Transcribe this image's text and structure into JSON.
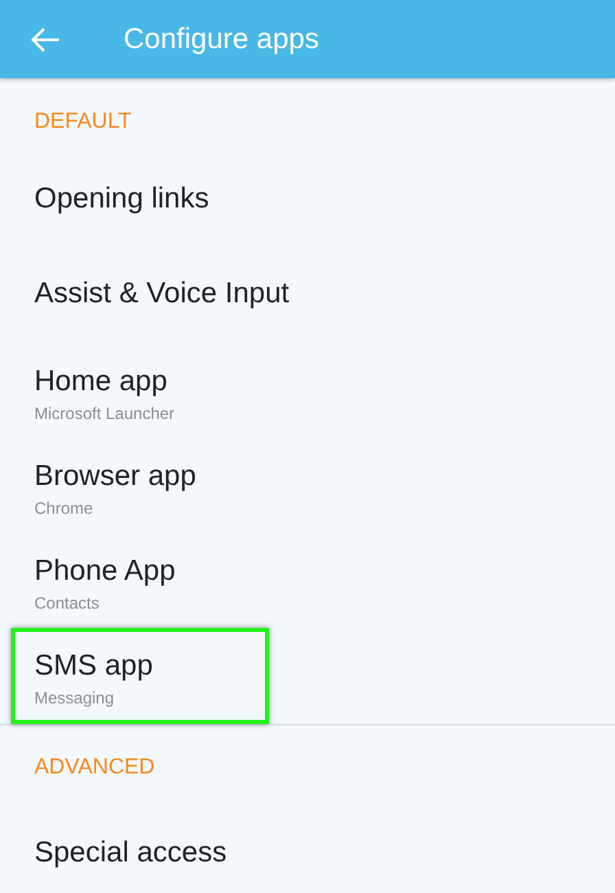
{
  "app_bar": {
    "title": "Configure apps"
  },
  "sections": [
    {
      "header": "DEFAULT",
      "items": [
        {
          "title": "Opening links",
          "highlighted": false
        },
        {
          "title": "Assist & Voice Input",
          "highlighted": false
        },
        {
          "title": "Home app",
          "summary": "Microsoft Launcher",
          "highlighted": false
        },
        {
          "title": "Browser app",
          "summary": "Chrome",
          "highlighted": false
        },
        {
          "title": "Phone App",
          "summary": "Contacts",
          "highlighted": false
        },
        {
          "title": "SMS app",
          "summary": "Messaging",
          "highlighted": true
        }
      ]
    },
    {
      "header": "ADVANCED",
      "items": [
        {
          "title": "Special access",
          "highlighted": false
        }
      ]
    }
  ]
}
